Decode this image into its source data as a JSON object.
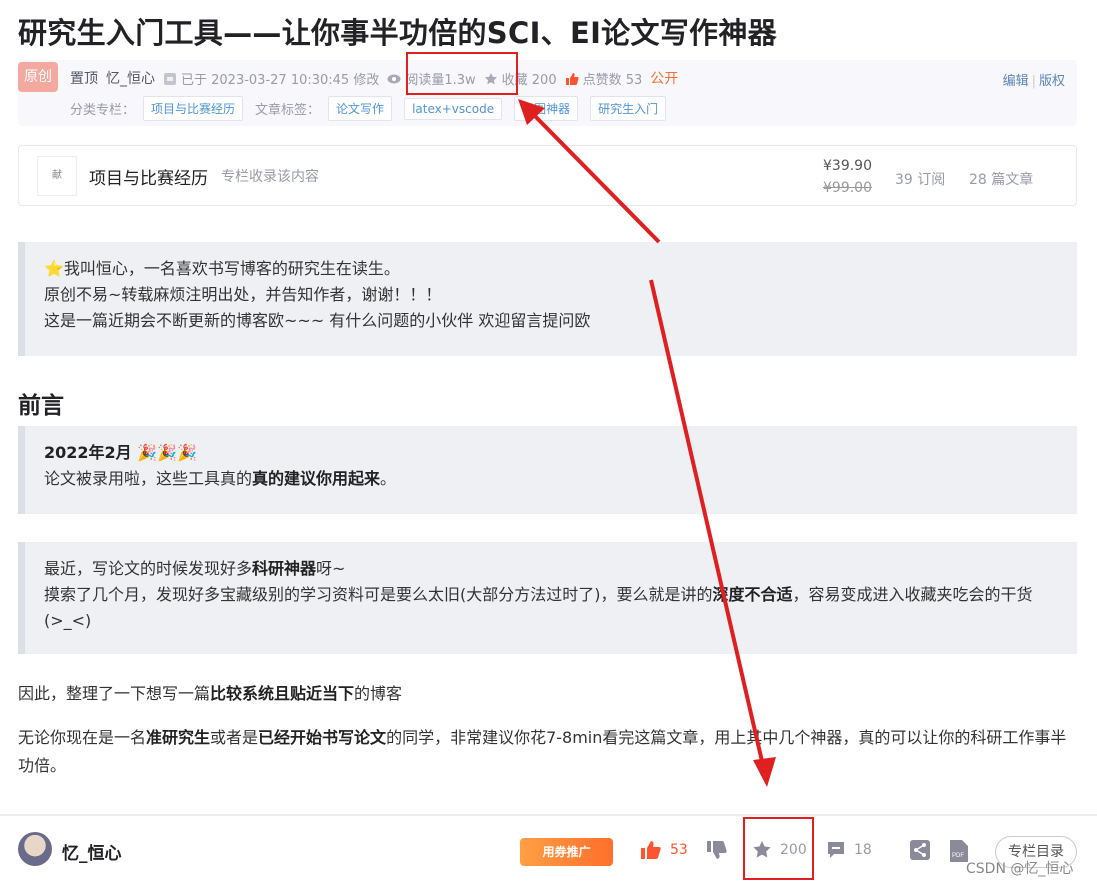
{
  "article": {
    "title": "研究生入门工具——让你事半功倍的SCI、EI论文写作神器",
    "badge": "原创",
    "pinned": "置顶",
    "author": "忆_恒心",
    "modified": "已于 2023-03-27 10:30:45 修改",
    "reads": "阅读量1.3w",
    "favorites": "收藏 200",
    "likes": "点赞数 53",
    "visibility": "公开",
    "edit": "编辑",
    "copyright": "版权",
    "category_label": "分类专栏：",
    "category": "项目与比赛经历",
    "tags_label": "文章标签：",
    "tags": [
      "论文写作",
      "latex+vscode",
      "画图神器",
      "研究生入门"
    ]
  },
  "column": {
    "thumb": "献",
    "name": "项目与比赛经历",
    "sub": "专栏收录该内容",
    "price": "¥39.90",
    "old_price": "¥99.00",
    "subscribers": "39 订阅",
    "articles": "28 篇文章"
  },
  "content": {
    "intro_1": "⭐我叫恒心，一名喜欢书写博客的研究生在读生。",
    "intro_2": "原创不易~转载麻烦注明出处，并告知作者，谢谢！！！",
    "intro_3": "这是一篇近期会不断更新的博客欧~~~  有什么问题的小伙伴 欢迎留言提问欧",
    "preface": "前言",
    "date_line": "2022年2月 🎉🎉🎉",
    "accepted_a": "论文被录用啦，这些工具真的",
    "accepted_b": "真的建议你用起来",
    "accepted_c": "。",
    "recent_a": "最近，写论文的时候发现好多",
    "recent_b": "科研神器",
    "recent_c": "呀~",
    "search_a": "摸索了几个月，发现好多宝藏级别的学习资料可是要么太旧(大部分方法过时了)，要么就是讲的",
    "search_b": "深度不合适",
    "search_c": "，容易变成进入收藏夹吃会的干货(>_<)",
    "p1_a": "因此，整理了一下想写一篇",
    "p1_b": "比较系统且贴近当下",
    "p1_c": "的博客",
    "p2_a": "无论你现在是一名",
    "p2_b": "准研究生",
    "p2_c": "或者是",
    "p2_d": "已经开始书写论文",
    "p2_e": "的同学，非常建议你花7-8min看完这篇文章，用上其中几个神器，真的可以让你的科研工作事半功倍。"
  },
  "toolbar": {
    "author": "忆_恒心",
    "promo": "用券推广",
    "likes": "53",
    "favorites": "200",
    "comments": "18",
    "toc": "专栏目录",
    "watermark": "CSDN @忆_恒心"
  },
  "colors": {
    "accent_red": "#e02020",
    "like_orange": "#fc5531",
    "tag_blue": "#5094d5"
  }
}
